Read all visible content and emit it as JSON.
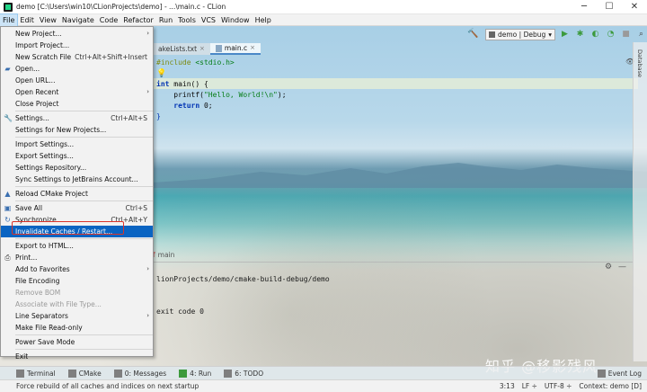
{
  "window": {
    "title": "demo [C:\\Users\\win10\\CLionProjects\\demo] - ...\\main.c - CLion",
    "minimize": "─",
    "maximize": "☐",
    "close": "✕"
  },
  "menubar": [
    "File",
    "Edit",
    "View",
    "Navigate",
    "Code",
    "Refactor",
    "Run",
    "Tools",
    "VCS",
    "Window",
    "Help"
  ],
  "toolbar": {
    "run_config": "demo | Debug",
    "icons": [
      "hammer-icon",
      "run-icon",
      "debug-icon",
      "coverage-icon",
      "profile-icon",
      "stop-icon",
      "search-icon"
    ]
  },
  "tabs": [
    {
      "label": "akeLists.txt",
      "active": false
    },
    {
      "label": "main.c",
      "active": true
    }
  ],
  "editor": {
    "line1_include": "#include",
    "line1_header": "<stdio.h>",
    "line3_type": "int",
    "line3_rest": " main() {",
    "line4_call": "    printf(",
    "line4_string": "\"Hello, World!\\n\"",
    "line4_end": ");",
    "line5_return": "    return",
    "line5_rest": " 0;",
    "line6": "}"
  },
  "right_strip": {
    "label": "Database"
  },
  "run_panel": {
    "tab_label": "main",
    "output_line1": "lionProjects/demo/cmake-build-debug/demo",
    "output_line2": "exit code 0"
  },
  "file_menu": [
    {
      "label": "New Project...",
      "shortcut": "",
      "icon": "",
      "submenu": false
    },
    {
      "label": "Import Project...",
      "shortcut": "",
      "icon": "",
      "submenu": false
    },
    {
      "label": "New Scratch File",
      "shortcut": "Ctrl+Alt+Shift+Insert",
      "icon": "",
      "submenu": false
    },
    {
      "label": "Open...",
      "shortcut": "",
      "icon": "folder-icon",
      "submenu": false
    },
    {
      "label": "Open URL...",
      "shortcut": "",
      "icon": "",
      "submenu": false
    },
    {
      "label": "Open Recent",
      "shortcut": "",
      "icon": "",
      "submenu": true
    },
    {
      "label": "Close Project",
      "shortcut": "",
      "icon": "",
      "submenu": false
    },
    {
      "label": "Settings...",
      "shortcut": "Ctrl+Alt+S",
      "icon": "wrench-icon",
      "submenu": false
    },
    {
      "label": "Settings for New Projects...",
      "shortcut": "",
      "icon": "",
      "submenu": false
    },
    {
      "label": "Import Settings...",
      "shortcut": "",
      "icon": "",
      "submenu": false
    },
    {
      "label": "Export Settings...",
      "shortcut": "",
      "icon": "",
      "submenu": false
    },
    {
      "label": "Settings Repository...",
      "shortcut": "",
      "icon": "",
      "submenu": false
    },
    {
      "label": "Sync Settings to JetBrains Account...",
      "shortcut": "",
      "icon": "",
      "submenu": false
    },
    {
      "label": "Reload CMake Project",
      "shortcut": "",
      "icon": "cmake-reload-icon",
      "submenu": false
    },
    {
      "label": "Save All",
      "shortcut": "Ctrl+S",
      "icon": "save-icon",
      "submenu": false
    },
    {
      "label": "Synchronize",
      "shortcut": "Ctrl+Alt+Y",
      "icon": "sync-icon",
      "submenu": false
    },
    {
      "label": "Invalidate Caches / Restart...",
      "shortcut": "",
      "icon": "",
      "submenu": false
    },
    {
      "label": "Export to HTML...",
      "shortcut": "",
      "icon": "",
      "submenu": false
    },
    {
      "label": "Print...",
      "shortcut": "",
      "icon": "print-icon",
      "submenu": false
    },
    {
      "label": "Add to Favorites",
      "shortcut": "",
      "icon": "",
      "submenu": true
    },
    {
      "label": "File Encoding",
      "shortcut": "",
      "icon": "",
      "submenu": false
    },
    {
      "label": "Remove BOM",
      "shortcut": "",
      "icon": "",
      "submenu": false
    },
    {
      "label": "Associate with File Type...",
      "shortcut": "",
      "icon": "",
      "submenu": false
    },
    {
      "label": "Line Separators",
      "shortcut": "",
      "icon": "",
      "submenu": true
    },
    {
      "label": "Make File Read-only",
      "shortcut": "",
      "icon": "",
      "submenu": false
    },
    {
      "label": "Power Save Mode",
      "shortcut": "",
      "icon": "",
      "submenu": false
    },
    {
      "label": "Exit",
      "shortcut": "",
      "icon": "",
      "submenu": false
    }
  ],
  "toolwindows": [
    {
      "label": "Terminal"
    },
    {
      "label": "CMake"
    },
    {
      "label": "0: Messages"
    },
    {
      "label": "4: Run"
    },
    {
      "label": "6: TODO"
    }
  ],
  "event_log": "Event Log",
  "status": {
    "message": "Force rebuild of all caches and indices on next startup",
    "position": "3:13",
    "line_sep": "LF ÷",
    "encoding": "UTF-8 ÷",
    "context": "Context: demo [D]"
  },
  "watermark": "知乎 @移影残风"
}
